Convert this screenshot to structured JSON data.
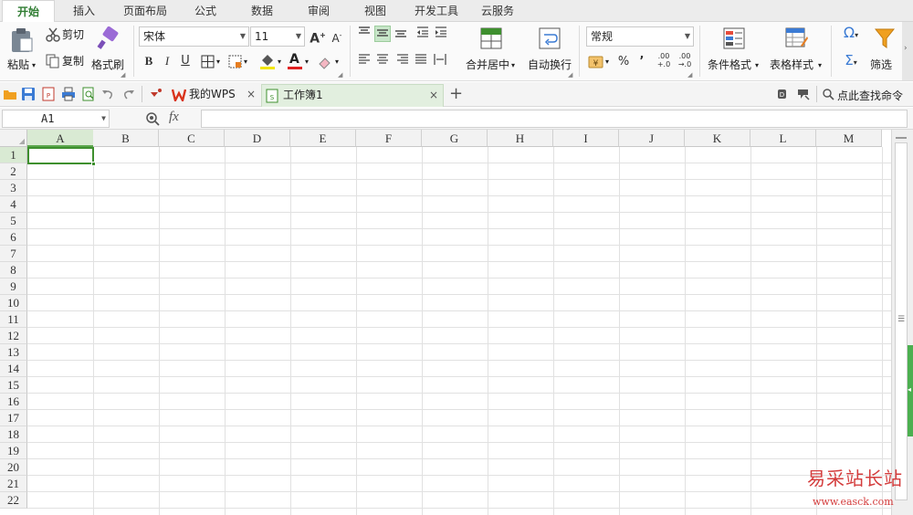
{
  "menu": {
    "tabs": [
      "开始",
      "插入",
      "页面布局",
      "公式",
      "数据",
      "审阅",
      "视图",
      "开发工具",
      "云服务"
    ],
    "active": "开始"
  },
  "ribbon": {
    "clipboard": {
      "paste": "粘贴",
      "cut": "剪切",
      "copy": "复制",
      "format_painter": "格式刷"
    },
    "font": {
      "family": "宋体",
      "size": "11",
      "bold": "B",
      "italic": "I",
      "underline": "U",
      "font_color_letter": "A"
    },
    "alignment": {
      "merge_center": "合并居中",
      "wrap_text": "自动换行"
    },
    "number": {
      "format": "常规",
      "percent": "%",
      "comma": "’",
      "inc_decimal": ".00\n+.0",
      "dec_decimal": ".00\n→.0"
    },
    "styles": {
      "conditional": "条件格式",
      "table_style": "表格样式"
    },
    "editing": {
      "symbol": "Ω",
      "sum": "Σ",
      "filter": "筛选"
    }
  },
  "qat": {
    "doc_tabs": [
      {
        "label": "我的WPS",
        "close": "×"
      },
      {
        "label": "工作簿1",
        "close": "×"
      }
    ],
    "new_tab": "+",
    "search": "点此查找命令"
  },
  "formula_bar": {
    "cell_ref": "A1",
    "fx": "fx",
    "value": ""
  },
  "sheet": {
    "columns": [
      "A",
      "B",
      "C",
      "D",
      "E",
      "F",
      "G",
      "H",
      "I",
      "J",
      "K",
      "L",
      "M"
    ],
    "rows": [
      "1",
      "2",
      "3",
      "4",
      "5",
      "6",
      "7",
      "8",
      "9",
      "10",
      "11",
      "12",
      "13",
      "14",
      "15",
      "16",
      "17",
      "18",
      "19",
      "20",
      "21",
      "22"
    ],
    "selected_cell": "A1"
  },
  "watermark": {
    "text": "易采站长站",
    "url": "www.easck.com"
  },
  "colors": {
    "accent": "#3e8f2e",
    "tab_active_text": "#2f7d32"
  }
}
